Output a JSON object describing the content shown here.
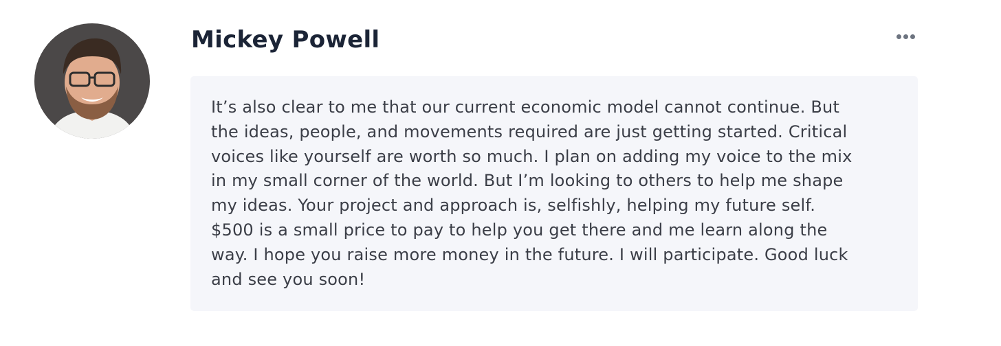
{
  "comment": {
    "author": "Mickey Powell",
    "avatar": "person-avatar",
    "more_icon": "ellipsis-icon",
    "text": "It’s also clear to me that our current economic model cannot continue. But\nthe ideas, people, and movements required are just getting started. Critical\nvoices like yourself are worth so much. I plan on adding my voice to the mix\nin my small corner of the world. But I’m looking to others to help me shape\nmy ideas. Your project and approach is, selfishly, helping my future self.\n$500 is a small price to pay to help you get there and me learn along the\nway. I hope you raise more money in the future. I will participate. Good luck\nand see you soon!"
  },
  "colors": {
    "author_text": "#1b2436",
    "body_text": "#3b3e47",
    "bubble_bg": "#f5f6fa",
    "icon": "#6d7480"
  }
}
